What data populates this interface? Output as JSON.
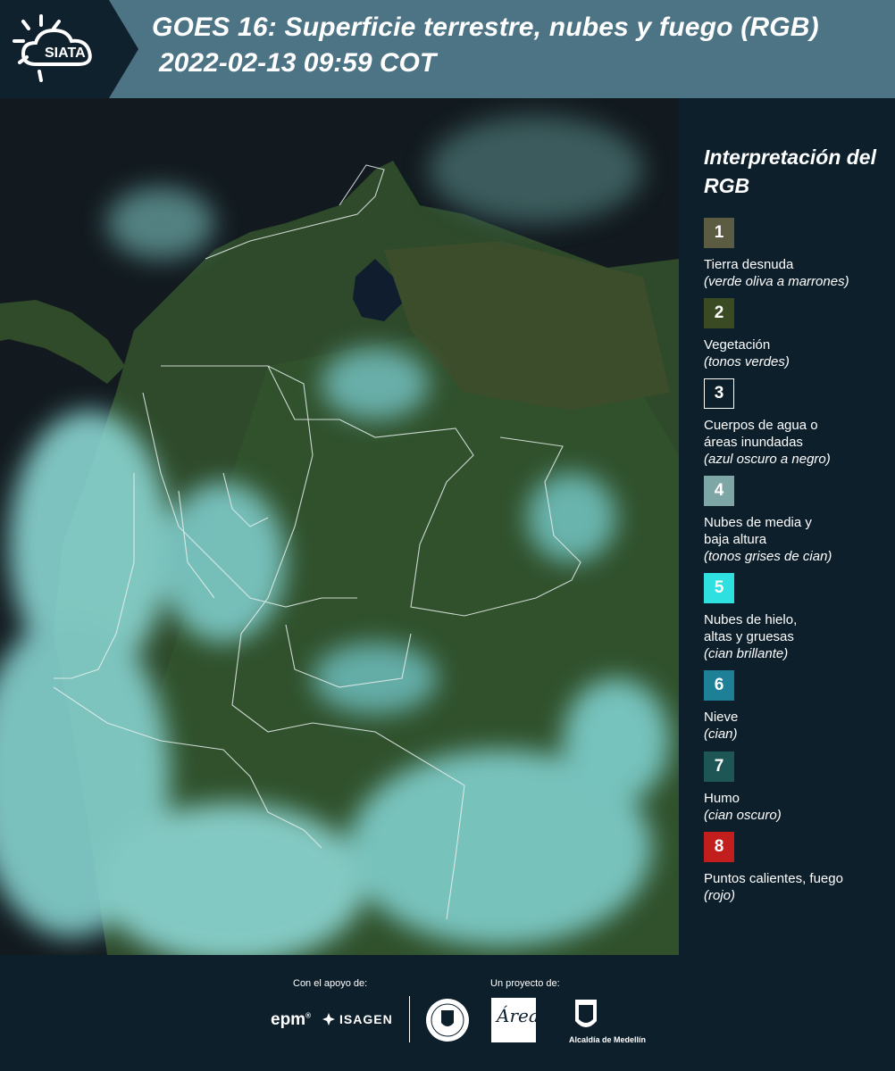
{
  "header": {
    "logo_text": "SIATA",
    "title_line1": "GOES 16: Superficie terrestre, nubes y fuego (RGB)",
    "title_line2": "2022-02-13 09:59 COT"
  },
  "legend": {
    "title": "Interpretación del RGB",
    "items": [
      {
        "num": "1",
        "color": "#5c5c43",
        "label": "Tierra desnuda",
        "sub": "(verde oliva a marrones)"
      },
      {
        "num": "2",
        "color": "#3a4a22",
        "label": "Vegetación",
        "sub": "(tonos verdes)"
      },
      {
        "num": "3",
        "color": "#0d1f2b",
        "label": "Cuerpos de agua o áreas inundadas",
        "sub": "(azul oscuro a negro)"
      },
      {
        "num": "4",
        "color": "#7fa6a6",
        "label": "Nubes de media y baja altura",
        "sub": "(tonos grises de cian)"
      },
      {
        "num": "5",
        "color": "#2fe0e0",
        "label": "Nubes de hielo, altas y gruesas",
        "sub": "(cian brillante)"
      },
      {
        "num": "6",
        "color": "#1e8096",
        "label": "Nieve",
        "sub": "(cian)"
      },
      {
        "num": "7",
        "color": "#1e5555",
        "label": "Humo",
        "sub": "(cian oscuro)"
      },
      {
        "num": "8",
        "color": "#c21e1e",
        "label": "Puntos calientes, fuego",
        "sub": "(rojo)"
      }
    ]
  },
  "footer": {
    "support_label": "Con el apoyo de:",
    "project_label": "Un proyecto de:",
    "sponsors": [
      "epm",
      "ISAGEN"
    ],
    "partners": [
      "Área Metropolitana",
      "Alcaldía de Medellín"
    ],
    "alcaldia_text": "Alcaldía de Medellín"
  }
}
